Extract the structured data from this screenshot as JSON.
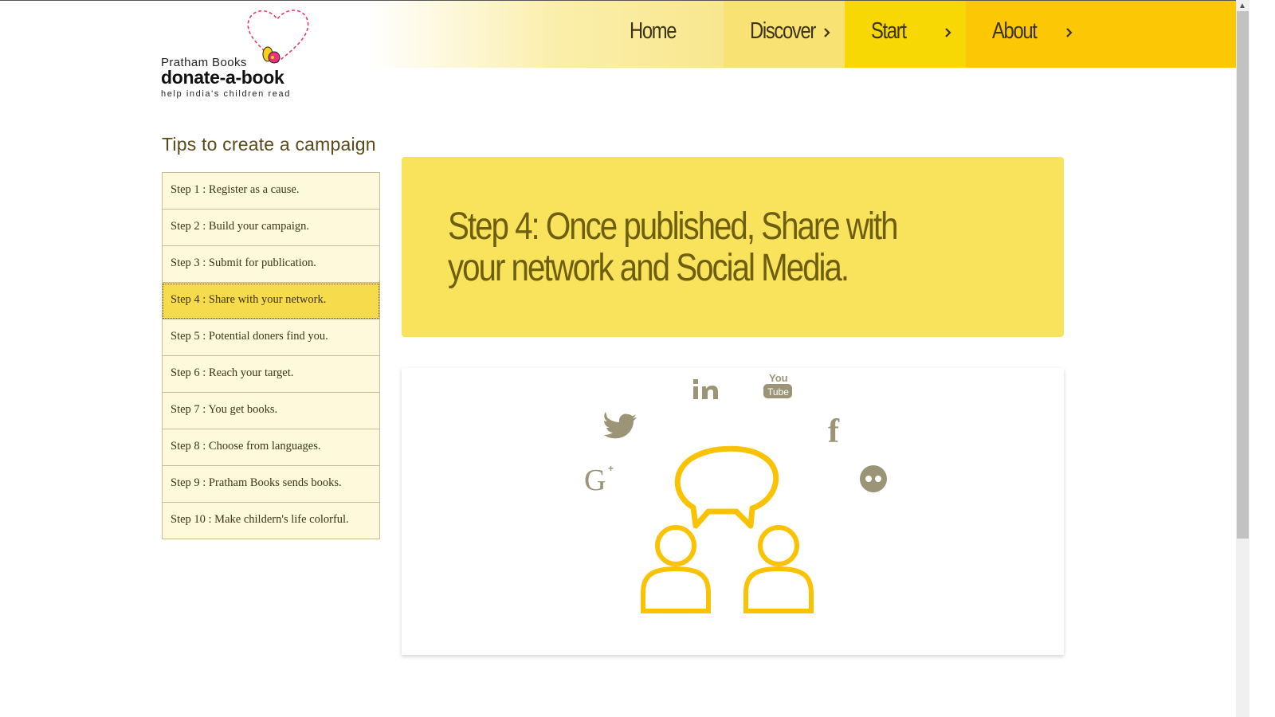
{
  "logo": {
    "publisher": "Pratham Books",
    "name": "donate-a-book",
    "tagline": "help india's children read"
  },
  "nav": {
    "items": [
      {
        "label": "Home",
        "has_chevron": false,
        "bg": "#f8e78f"
      },
      {
        "label": "Discover",
        "has_chevron": true,
        "bg": "#f9e274"
      },
      {
        "label": "Start",
        "has_chevron": true,
        "bg": "#f8d804"
      },
      {
        "label": "About",
        "has_chevron": true,
        "bg": "#fcc704"
      }
    ]
  },
  "sidebar": {
    "title": "Tips to create a campaign",
    "steps": [
      {
        "label": "Step 1 : Register as a cause."
      },
      {
        "label": "Step 2 : Build your campaign."
      },
      {
        "label": "Step 3 : Submit for publication."
      },
      {
        "label": "Step 4 : Share with your network."
      },
      {
        "label": "Step 5 : Potential doners find you."
      },
      {
        "label": "Step 6 : Reach your target."
      },
      {
        "label": "Step 7 : You get books."
      },
      {
        "label": "Step 8 : Choose from languages."
      },
      {
        "label": "Step 9 : Pratham Books sends books."
      },
      {
        "label": "Step 10 : Make childern's life colorful."
      }
    ],
    "active_index": 3
  },
  "main": {
    "heading": "Step 4: Once published, Share with your network and Social Media.",
    "illustration": {
      "social_icons": [
        "twitter-icon",
        "linkedin-icon",
        "youtube-icon",
        "facebook-icon",
        "google-plus-icon",
        "flickr-icon"
      ],
      "youtube_text_top": "You",
      "youtube_text_bottom": "Tube",
      "twitter_text": "",
      "facebook_text": "f",
      "gplus_text": "G",
      "linkedin_text": "in"
    }
  },
  "colors": {
    "accent_yellow": "#fcc704",
    "hero_bg": "#f9e35d",
    "hero_text": "#6e5e10",
    "icon_gray": "#9b9476",
    "illustration_stroke": "#f9c304"
  }
}
